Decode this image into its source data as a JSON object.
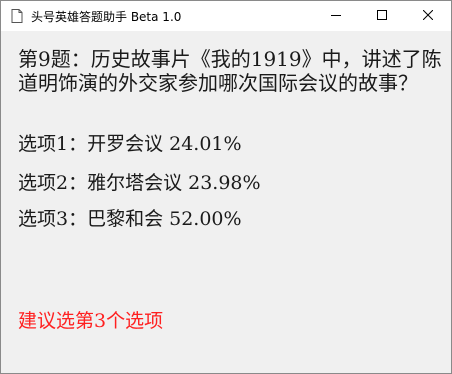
{
  "window": {
    "title": "头号英雄答题助手 Beta 1.0",
    "icon": "document-icon",
    "controls": [
      "minimize-icon",
      "maximize-icon",
      "close-icon"
    ]
  },
  "question": {
    "text": "第9题：历史故事片《我的1919》中，讲述了陈道明饰演的外交家参加哪次国际会议的故事？"
  },
  "options": [
    {
      "label": "选项1：开罗会议 24.01%",
      "percent": 24.01
    },
    {
      "label": "选项2：雅尔塔会议 23.98%",
      "percent": 23.98
    },
    {
      "label": "选项3：巴黎和会 52.00%",
      "percent": 52.0
    }
  ],
  "suggestion": {
    "text": "建议选第3个选项",
    "color": "#ff2020"
  }
}
